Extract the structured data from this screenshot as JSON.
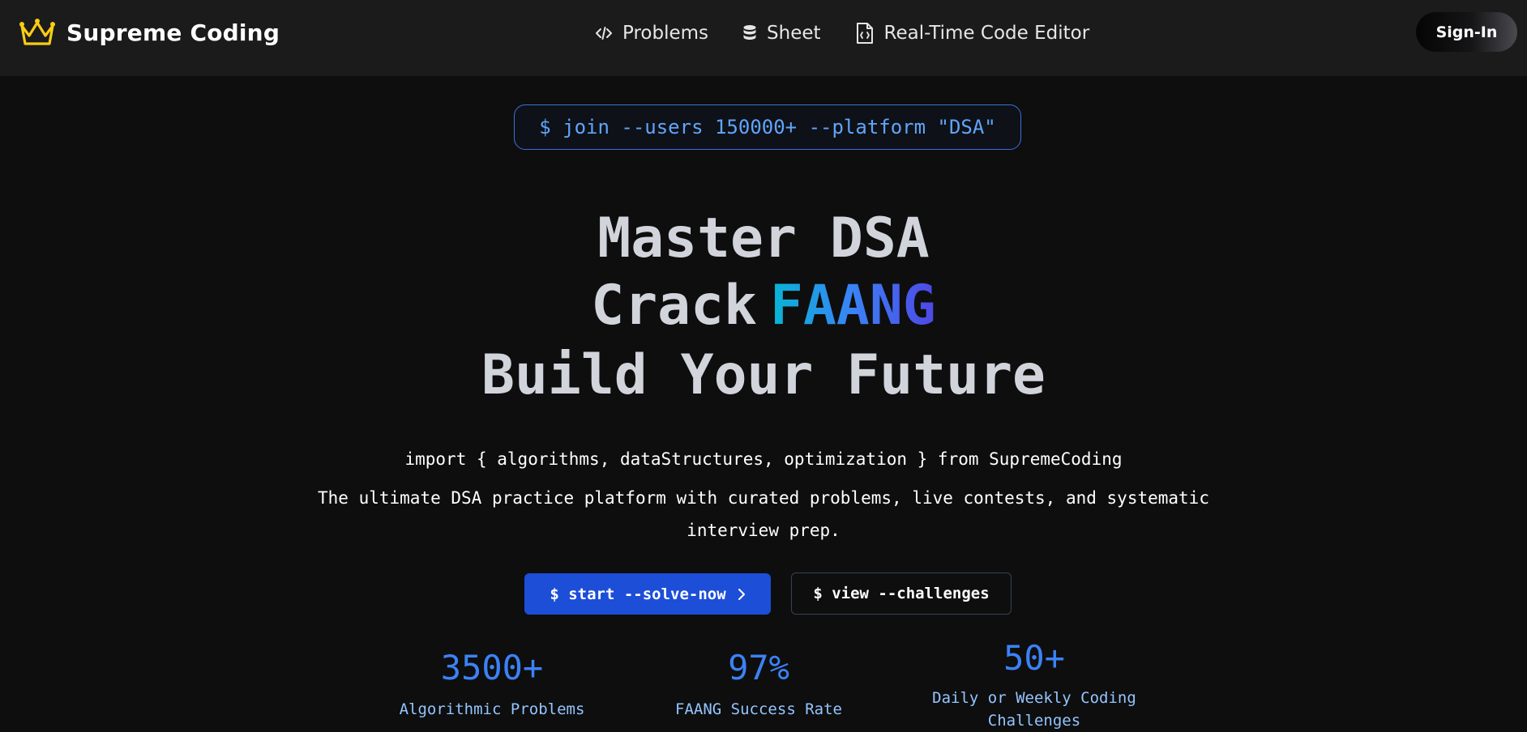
{
  "navbar": {
    "brand": "Supreme Coding",
    "links": [
      {
        "label": "Problems",
        "icon": "code-icon"
      },
      {
        "label": "Sheet",
        "icon": "database-icon"
      },
      {
        "label": "Real-Time Code Editor",
        "icon": "file-code-icon"
      }
    ],
    "signin_label": "Sign-In"
  },
  "hero": {
    "command": "$ join --users 150000+ --platform \"DSA\"",
    "line1": "Master DSA",
    "line2_prefix": "Crack",
    "line2_highlight": "FAANG",
    "line3": "Build Your Future",
    "subtitle_import": "import { algorithms, dataStructures, optimization } from SupremeCoding",
    "subtitle_desc": "The ultimate DSA practice platform with curated problems, live contests, and systematic interview prep."
  },
  "actions": {
    "primary_label": "$ start --solve-now",
    "secondary_label": "$ view --challenges"
  },
  "stats": [
    {
      "value": "3500+",
      "label": "Algorithmic Problems"
    },
    {
      "value": "97%",
      "label": "FAANG Success Rate"
    },
    {
      "value": "50+",
      "label": "Daily or Weekly Coding Challenges"
    }
  ],
  "colors": {
    "background": "#0e0e0f",
    "navbar": "#1b1b1c",
    "accent_blue": "#3b82f6",
    "primary_button": "#1d4ed8",
    "crown": "#facc15"
  }
}
